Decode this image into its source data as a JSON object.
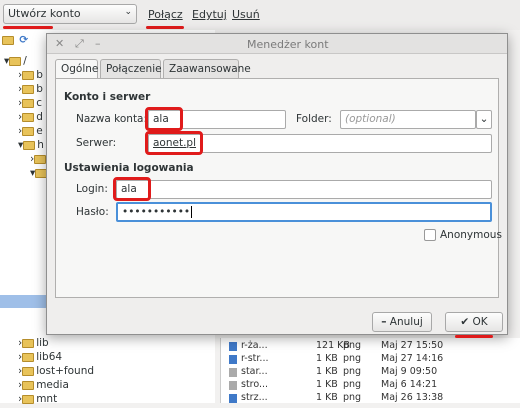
{
  "toolbar": {
    "account_select": "Utwórz konto",
    "connect": "Połącz",
    "edit": "Edytuj",
    "delete": "Usuń"
  },
  "tree": {
    "root": "/",
    "rows_top": [
      "b",
      "b",
      "c",
      "d",
      "e",
      "h",
      "",
      ""
    ],
    "rows_bottom": [
      "lib",
      "lib64",
      "lost+found",
      "media",
      "mnt"
    ]
  },
  "files": [
    {
      "name": "r-ża...",
      "size": "121 KB",
      "type": "png",
      "date": "Maj 27 15:50"
    },
    {
      "name": "r-str...",
      "size": "1 KB",
      "type": "png",
      "date": "Maj 27 14:16"
    },
    {
      "name": "star...",
      "size": "1 KB",
      "type": "png",
      "date": "Maj 9 09:50"
    },
    {
      "name": "stro...",
      "size": "1 KB",
      "type": "png",
      "date": "Maj 6 14:21"
    },
    {
      "name": "strz...",
      "size": "1 KB",
      "type": "png",
      "date": "Maj 26 13:38"
    }
  ],
  "dialog": {
    "title": "Menedżer kont",
    "tabs": [
      "Ogólne",
      "Połączenie",
      "Zaawansowane"
    ],
    "section_account": "Konto i serwer",
    "name_label": "Nazwa konta:",
    "name_value": "ala",
    "folder_label": "Folder:",
    "folder_placeholder": "(optional)",
    "server_label": "Serwer:",
    "server_value": "aonet.pl",
    "section_login": "Ustawienia logowania",
    "login_label": "Login:",
    "login_value": "ala",
    "password_label": "Hasło:",
    "password_value": "•••••••••••",
    "anonymous_label": "Anonymous",
    "cancel_label": "Anuluj",
    "ok_label": "OK",
    "accent_red": "#e01b1b"
  }
}
